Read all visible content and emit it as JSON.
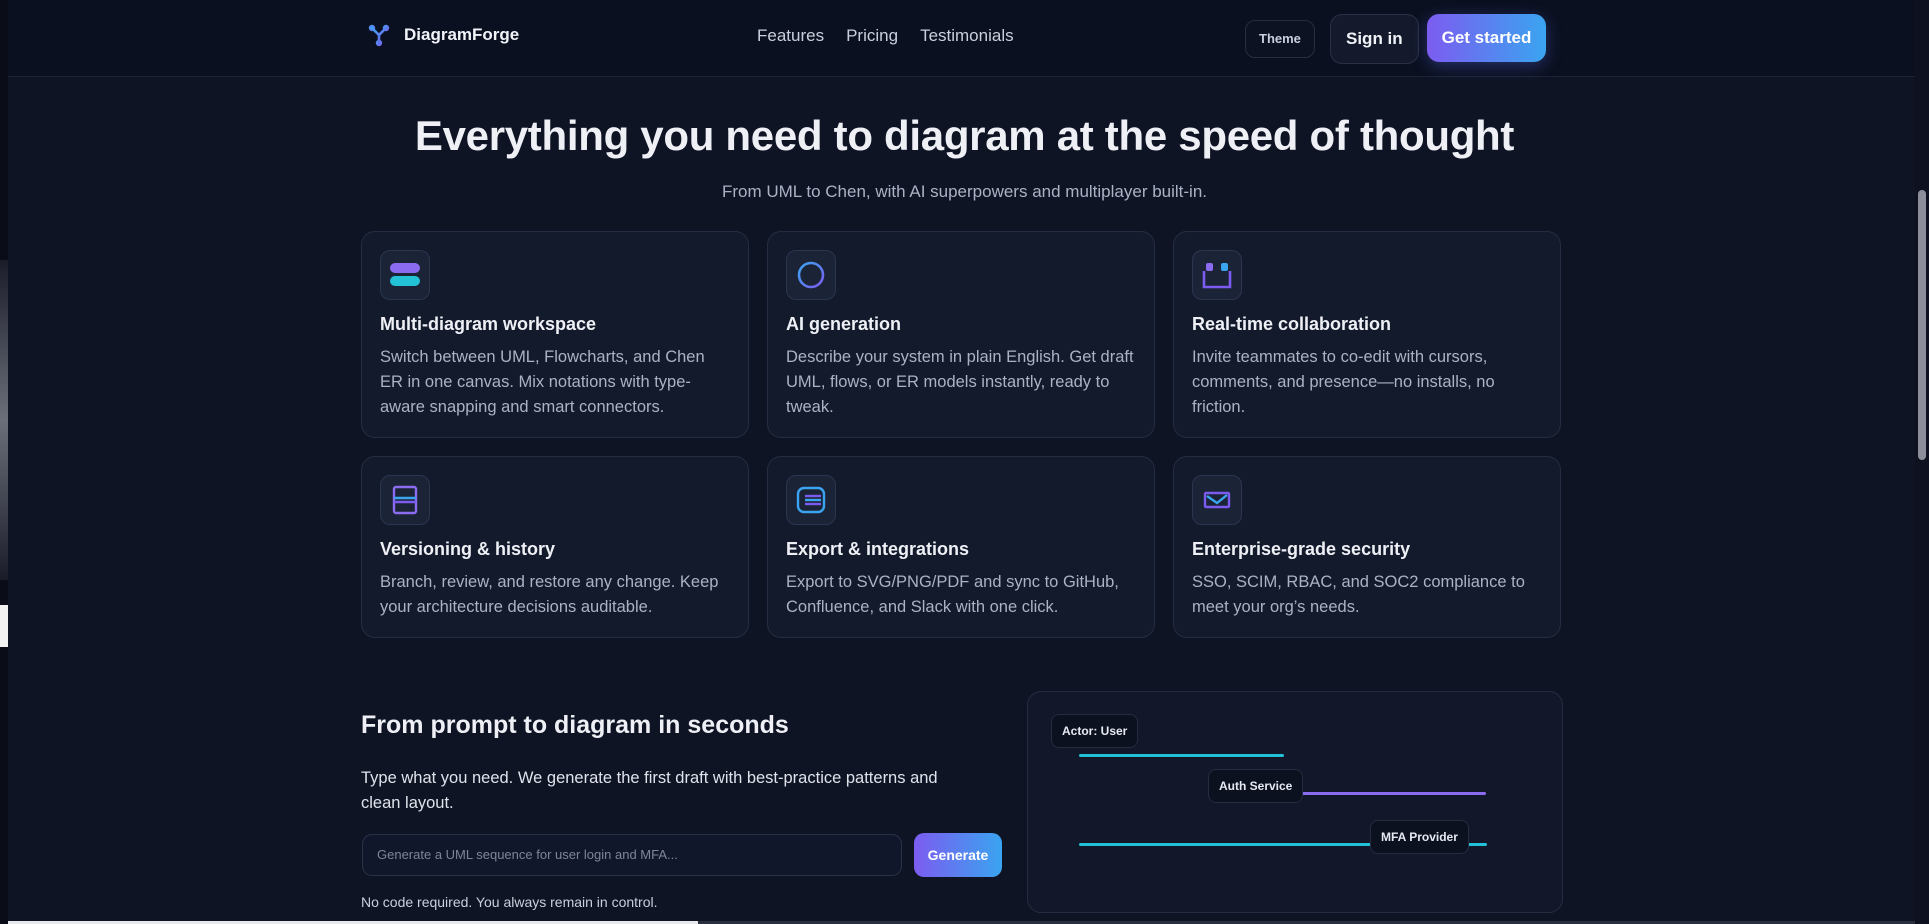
{
  "header": {
    "brand": "DiagramForge",
    "nav": [
      "Features",
      "Pricing",
      "Testimonials"
    ],
    "theme_label": "Theme",
    "signin_label": "Sign in",
    "cta_label": "Get started"
  },
  "hero": {
    "title": "Everything you need to diagram at the speed of thought",
    "subtitle": "From UML to Chen, with AI superpowers and multiplayer built-in."
  },
  "features": [
    {
      "icon": "stack-icon",
      "title": "Multi-diagram workspace",
      "desc": "Switch between UML, Flowcharts, and Chen ER in one canvas. Mix notations with type-aware snapping and smart connectors."
    },
    {
      "icon": "circle-icon",
      "title": "AI generation",
      "desc": "Describe your system in plain English. Get draft UML, flows, or ER models instantly, ready to tweak."
    },
    {
      "icon": "users-icon",
      "title": "Real-time collaboration",
      "desc": "Invite teammates to co-edit with cursors, comments, and presence—no installs, no friction."
    },
    {
      "icon": "panels-icon",
      "title": "Versioning & history",
      "desc": "Branch, review, and restore any change. Keep your architecture decisions auditable."
    },
    {
      "icon": "export-icon",
      "title": "Export & integrations",
      "desc": "Export to SVG/PNG/PDF and sync to GitHub, Confluence, and Slack with one click."
    },
    {
      "icon": "mail-shield-icon",
      "title": "Enterprise-grade security",
      "desc": "SSO, SCIM, RBAC, and SOC2 compliance to meet your org’s needs."
    }
  ],
  "prompt_section": {
    "title": "From prompt to diagram in seconds",
    "desc": "Type what you need. We generate the first draft with best-practice patterns and clean layout.",
    "input_placeholder": "Generate a UML sequence for user login and MFA...",
    "generate_label": "Generate",
    "note": "No code required. You always remain in control."
  },
  "preview": {
    "nodes": [
      "Actor: User",
      "Auth Service",
      "MFA Provider"
    ]
  },
  "colors": {
    "accent_start": "#7c5cf0",
    "accent_end": "#3aa4f0",
    "cyan": "#22c1d6",
    "violet": "#8b6cf0",
    "background": "#0f1424"
  }
}
